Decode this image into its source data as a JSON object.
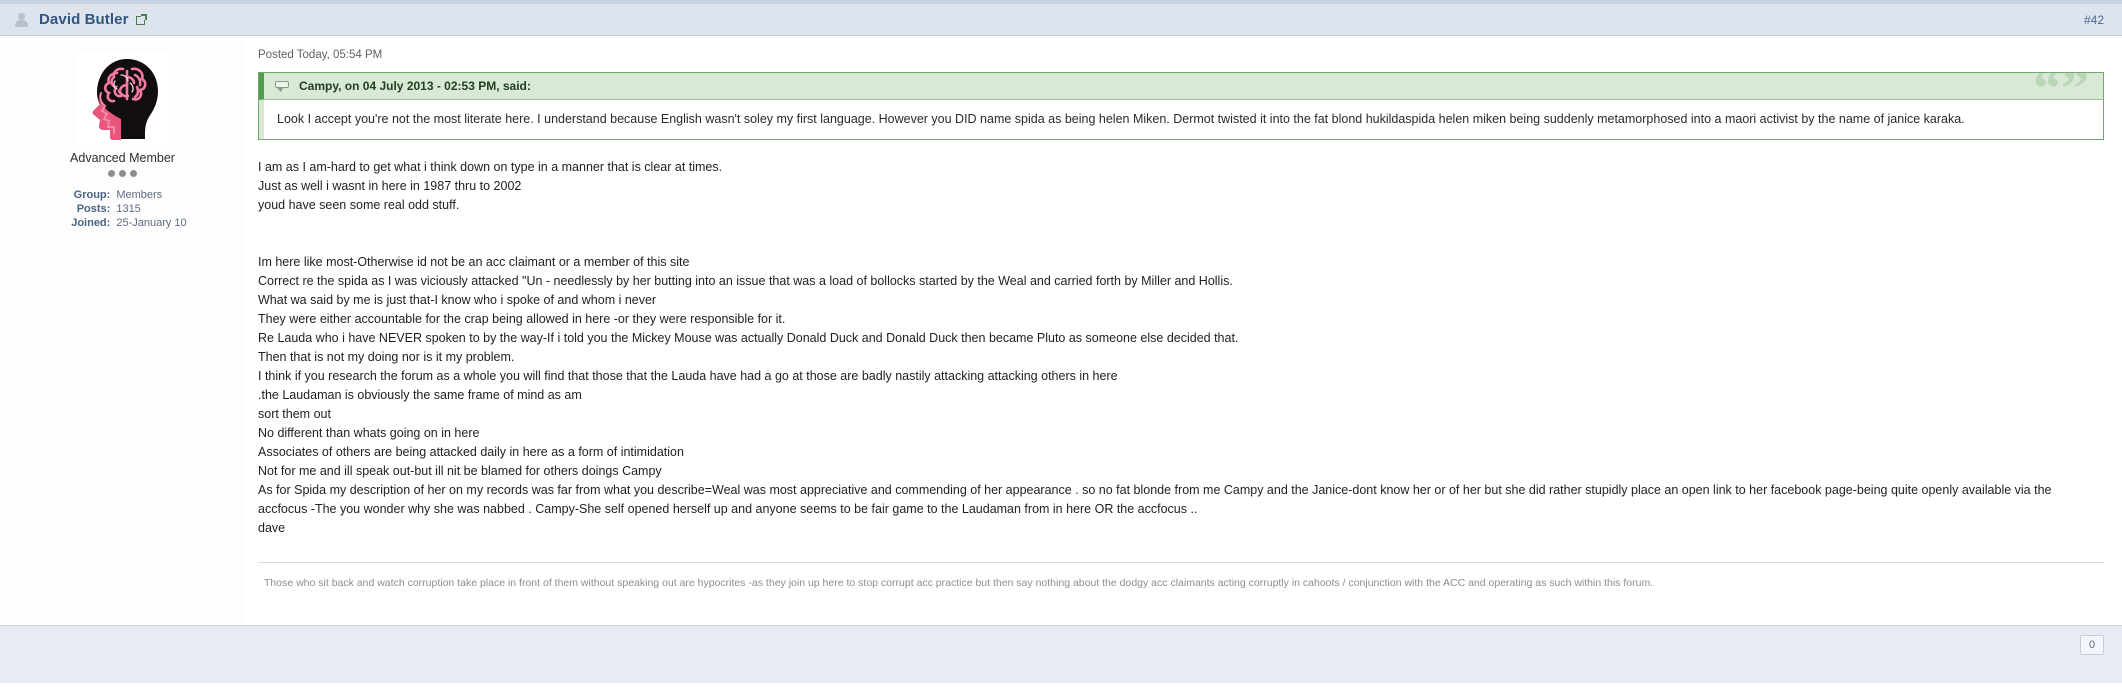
{
  "header": {
    "author": "David Butler",
    "author_icon": "user-icon",
    "profile_link_icon": "external-link-icon",
    "post_number": "#42"
  },
  "author_panel": {
    "avatar_alt": "brain-head-avatar",
    "member_title": "Advanced Member",
    "pip_count": 3,
    "stats": [
      {
        "label": "Group:",
        "value": "Members"
      },
      {
        "label": "Posts:",
        "value": "1315"
      },
      {
        "label": "Joined:",
        "value": "25-January 10"
      }
    ]
  },
  "post": {
    "posted_date": "Posted Today, 05:54 PM",
    "quote": {
      "icon": "quote-bubble-icon",
      "attribution": "Campy, on 04 July 2013 - 02:53 PM, said:",
      "decoration": "“”",
      "text": "Look I accept you're not the most literate here. I understand because English wasn't soley my first language. However you DID name spida as being helen Miken. Dermot twisted it into the fat blond hukildaspida helen miken being suddenly metamorphosed into a maori activist by the name of janice karaka."
    },
    "paragraph_one": [
      "I am as I am-hard to get what i think down on type in a manner that is clear at times.",
      "Just as well i wasnt in here in 1987 thru to 2002",
      "youd have seen some real odd stuff."
    ],
    "paragraph_two": [
      "Im here like most-Otherwise id not be an acc claimant or a member of this site",
      "Correct re the spida as I was viciously attacked \"Un - needlessly by her butting into an issue that was a load of bollocks started by the Weal and carried forth by Miller and Hollis.",
      "What wa said by me is just that-I know who i spoke of and whom i never",
      "They were either accountable for the crap being allowed in here -or they were responsible for it.",
      "Re Lauda who i have NEVER spoken to by the way-If i told you the Mickey Mouse was actually Donald Duck and Donald Duck then became Pluto as someone else decided that.",
      "Then that is not my doing nor is it my problem.",
      "I think if you research the forum as a whole you will find that those that the Lauda have had a go at those are badly nastily attacking attacking others in here",
      ".the Laudaman is obviously the same frame of mind as am",
      "sort them out",
      "No different than whats going on in here",
      "Associates of others are being attacked daily in here as a form of intimidation",
      "Not for me and ill speak out-but ill nit be blamed for others doings Campy",
      "As for Spida my description of her on my records was far from what you describe=Weal was most appreciative and commending of her appearance . so no fat blonde from me Campy and the Janice-dont know her or of her but she did rather stupidly place an open link to her facebook page-being quite openly available via the accfocus -The you wonder why she was nabbed . Campy-She self opened herself up and anyone seems to be fair game to the Laudaman from in here OR the accfocus ..",
      "dave"
    ],
    "signature": "Those who sit back and watch corruption take place in front of them without speaking out are hypocrites -as they join up here to stop corrupt acc practice but then say nothing about the dodgy acc claimants acting corruptly in cahoots / conjunction with the ACC and operating as such within this forum."
  },
  "footer": {
    "reputation": "0"
  },
  "colors": {
    "header_bar": "#dde4ee",
    "author_name": "#34557e",
    "quote_accent": "#4f9e4f",
    "quote_head_bg": "#d8e9d6",
    "footer_bg": "#e7ecf4"
  }
}
